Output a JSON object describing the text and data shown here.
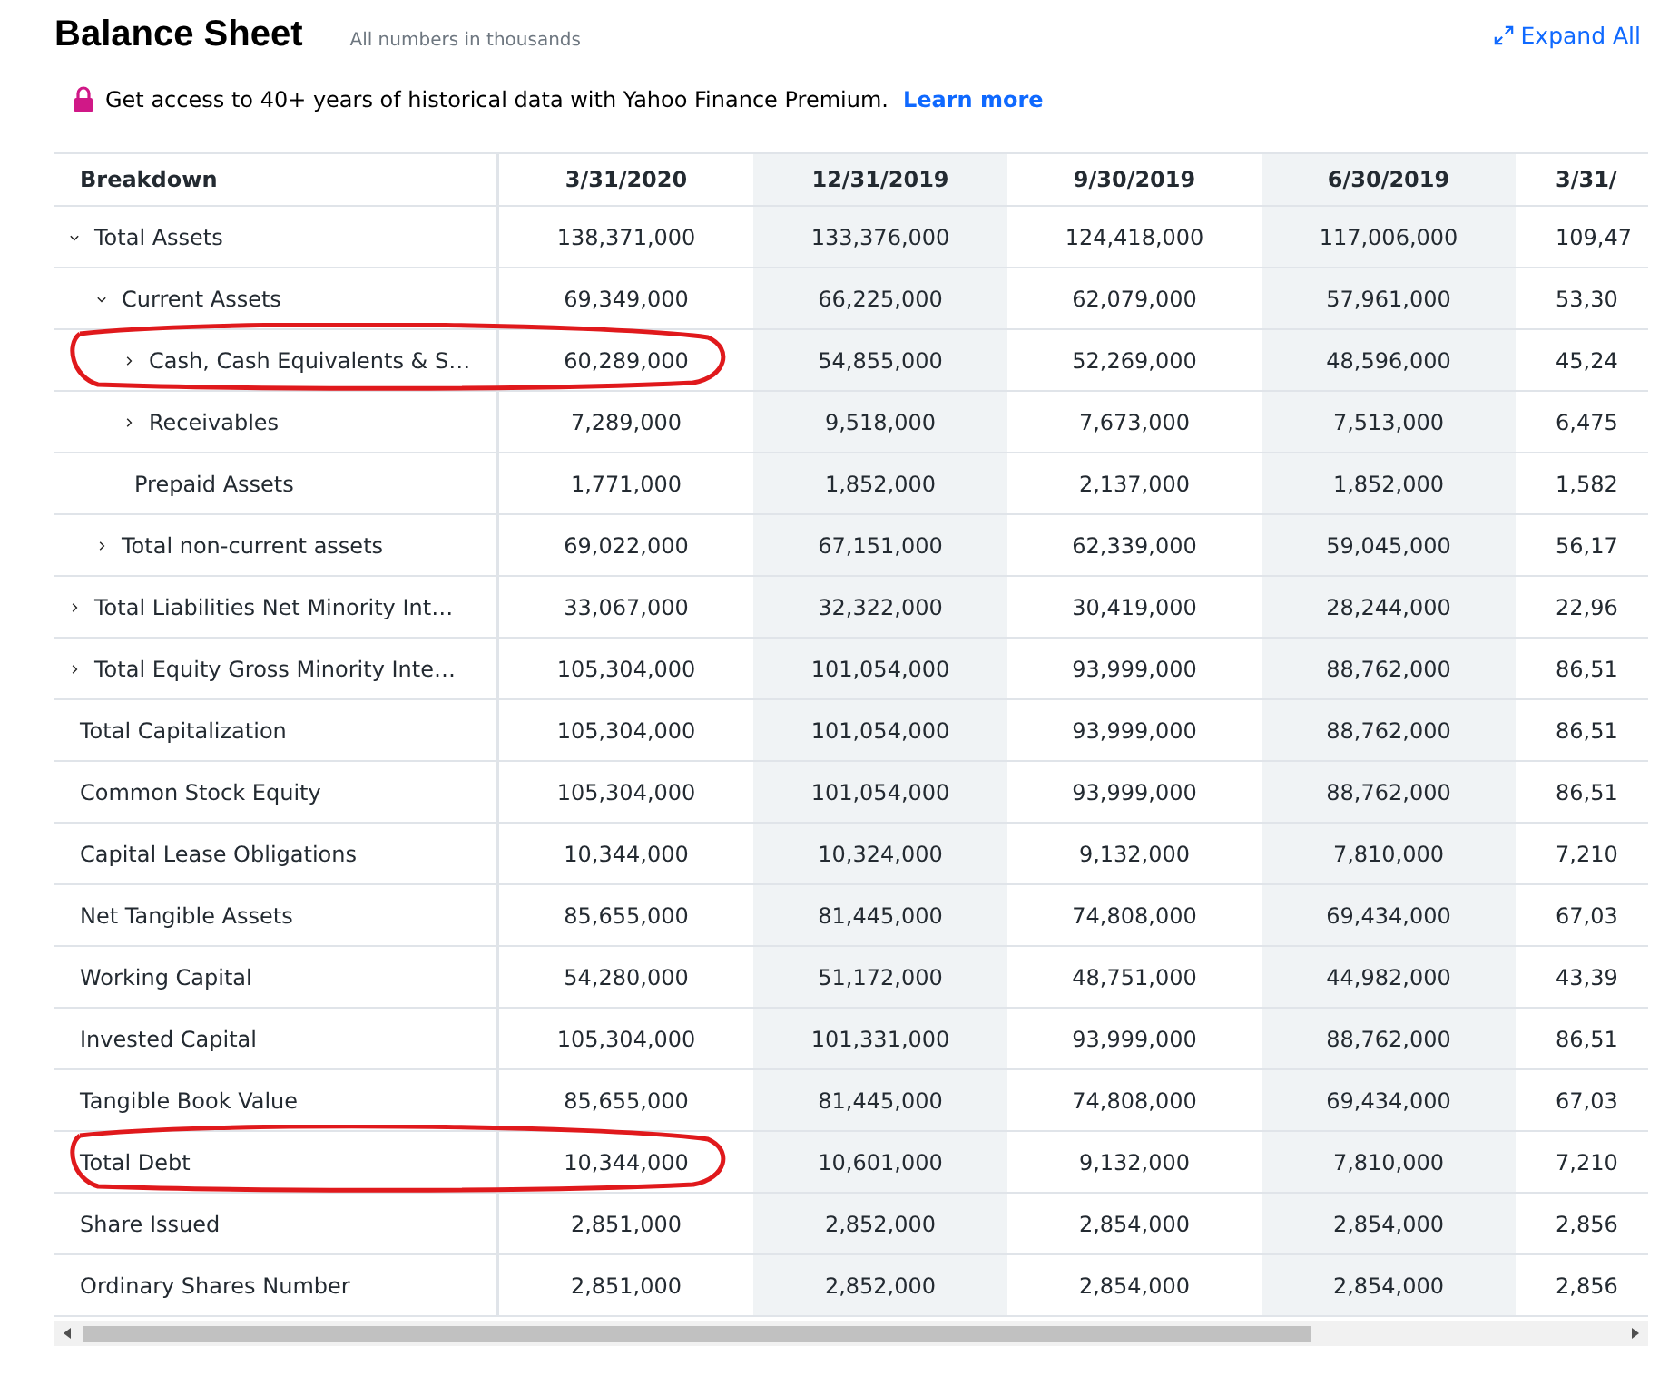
{
  "header": {
    "title": "Balance Sheet",
    "subtitle": "All numbers in thousands",
    "expand_all": "Expand All"
  },
  "promo": {
    "text": "Get access to 40+ years of historical data with Yahoo Finance Premium.",
    "link": "Learn more"
  },
  "table": {
    "columns": [
      "Breakdown",
      "3/31/2020",
      "12/31/2019",
      "9/30/2019",
      "6/30/2019",
      "3/31/"
    ],
    "rows": [
      {
        "kind": "group",
        "label": "Total Assets",
        "expanded": true,
        "circled": false,
        "values": [
          "138,371,000",
          "133,376,000",
          "124,418,000",
          "117,006,000",
          "109,47"
        ],
        "children": [
          {
            "kind": "group",
            "label": "Current Assets",
            "expanded": true,
            "circled": false,
            "values": [
              "69,349,000",
              "66,225,000",
              "62,079,000",
              "57,961,000",
              "53,30"
            ],
            "children": [
              {
                "kind": "group",
                "label": "Cash, Cash Equivalents & S…",
                "expanded": false,
                "circled": true,
                "values": [
                  "60,289,000",
                  "54,855,000",
                  "52,269,000",
                  "48,596,000",
                  "45,24"
                ]
              },
              {
                "kind": "group",
                "label": "Receivables",
                "expanded": false,
                "circled": false,
                "values": [
                  "7,289,000",
                  "9,518,000",
                  "7,673,000",
                  "7,513,000",
                  "6,475"
                ]
              },
              {
                "kind": "leaf",
                "label": "Prepaid Assets",
                "circled": false,
                "values": [
                  "1,771,000",
                  "1,852,000",
                  "2,137,000",
                  "1,852,000",
                  "1,582"
                ]
              }
            ]
          },
          {
            "kind": "group",
            "label": "Total non-current assets",
            "expanded": false,
            "circled": false,
            "values": [
              "69,022,000",
              "67,151,000",
              "62,339,000",
              "59,045,000",
              "56,17"
            ]
          }
        ]
      },
      {
        "kind": "group",
        "label": "Total Liabilities Net Minority Int…",
        "expanded": false,
        "circled": false,
        "values": [
          "33,067,000",
          "32,322,000",
          "30,419,000",
          "28,244,000",
          "22,96"
        ]
      },
      {
        "kind": "group",
        "label": "Total Equity Gross Minority Inte…",
        "expanded": false,
        "circled": false,
        "values": [
          "105,304,000",
          "101,054,000",
          "93,999,000",
          "88,762,000",
          "86,51"
        ]
      },
      {
        "kind": "leaf",
        "label": "Total Capitalization",
        "circled": false,
        "values": [
          "105,304,000",
          "101,054,000",
          "93,999,000",
          "88,762,000",
          "86,51"
        ]
      },
      {
        "kind": "leaf",
        "label": "Common Stock Equity",
        "circled": false,
        "values": [
          "105,304,000",
          "101,054,000",
          "93,999,000",
          "88,762,000",
          "86,51"
        ]
      },
      {
        "kind": "leaf",
        "label": "Capital Lease Obligations",
        "circled": false,
        "values": [
          "10,344,000",
          "10,324,000",
          "9,132,000",
          "7,810,000",
          "7,210"
        ]
      },
      {
        "kind": "leaf",
        "label": "Net Tangible Assets",
        "circled": false,
        "values": [
          "85,655,000",
          "81,445,000",
          "74,808,000",
          "69,434,000",
          "67,03"
        ]
      },
      {
        "kind": "leaf",
        "label": "Working Capital",
        "circled": false,
        "values": [
          "54,280,000",
          "51,172,000",
          "48,751,000",
          "44,982,000",
          "43,39"
        ]
      },
      {
        "kind": "leaf",
        "label": "Invested Capital",
        "circled": false,
        "values": [
          "105,304,000",
          "101,331,000",
          "93,999,000",
          "88,762,000",
          "86,51"
        ]
      },
      {
        "kind": "leaf",
        "label": "Tangible Book Value",
        "circled": false,
        "values": [
          "85,655,000",
          "81,445,000",
          "74,808,000",
          "69,434,000",
          "67,03"
        ]
      },
      {
        "kind": "leaf",
        "label": "Total Debt",
        "circled": true,
        "values": [
          "10,344,000",
          "10,601,000",
          "9,132,000",
          "7,810,000",
          "7,210"
        ]
      },
      {
        "kind": "leaf",
        "label": "Share Issued",
        "circled": false,
        "values": [
          "2,851,000",
          "2,852,000",
          "2,854,000",
          "2,854,000",
          "2,856"
        ]
      },
      {
        "kind": "leaf",
        "label": "Ordinary Shares Number",
        "circled": false,
        "values": [
          "2,851,000",
          "2,852,000",
          "2,854,000",
          "2,854,000",
          "2,856"
        ]
      }
    ]
  }
}
